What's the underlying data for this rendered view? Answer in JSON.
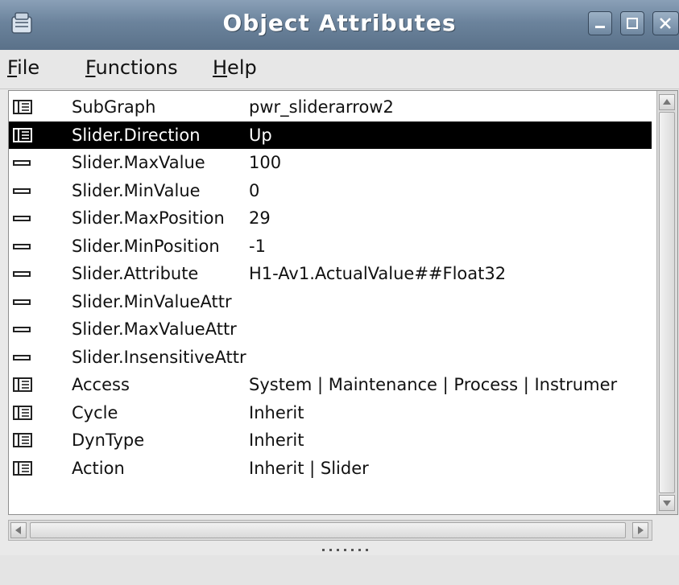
{
  "window": {
    "title": "Object Attributes"
  },
  "menu": [
    {
      "mnemonic": "F",
      "rest": "ile"
    },
    {
      "mnemonic": "F",
      "rest": "unctions"
    },
    {
      "mnemonic": "H",
      "rest": "elp"
    }
  ],
  "rows": [
    {
      "icon": "folder-icon",
      "name": "SubGraph",
      "value": "pwr_sliderarrow2",
      "selected": false
    },
    {
      "icon": "folder-icon",
      "name": "Slider.Direction",
      "value": "Up",
      "selected": true
    },
    {
      "icon": "attribute-icon",
      "name": "Slider.MaxValue",
      "value": "100",
      "selected": false
    },
    {
      "icon": "attribute-icon",
      "name": "Slider.MinValue",
      "value": "0",
      "selected": false
    },
    {
      "icon": "attribute-icon",
      "name": "Slider.MaxPosition",
      "value": "29",
      "selected": false
    },
    {
      "icon": "attribute-icon",
      "name": "Slider.MinPosition",
      "value": "-1",
      "selected": false
    },
    {
      "icon": "attribute-icon",
      "name": "Slider.Attribute",
      "value": "H1-Av1.ActualValue##Float32",
      "selected": false
    },
    {
      "icon": "attribute-icon",
      "name": "Slider.MinValueAttr",
      "value": "",
      "selected": false
    },
    {
      "icon": "attribute-icon",
      "name": "Slider.MaxValueAttr",
      "value": "",
      "selected": false
    },
    {
      "icon": "attribute-icon",
      "name": "Slider.InsensitiveAttr",
      "value": "",
      "selected": false
    },
    {
      "icon": "folder-icon",
      "name": "Access",
      "value": "System | Maintenance | Process | Instrumer",
      "selected": false
    },
    {
      "icon": "folder-icon",
      "name": "Cycle",
      "value": "Inherit",
      "selected": false
    },
    {
      "icon": "folder-icon",
      "name": "DynType",
      "value": "Inherit",
      "selected": false
    },
    {
      "icon": "folder-icon",
      "name": "Action",
      "value": "Inherit | Slider",
      "selected": false
    }
  ],
  "colors": {
    "titlebar": "#6b839c",
    "selection": "#000000"
  }
}
